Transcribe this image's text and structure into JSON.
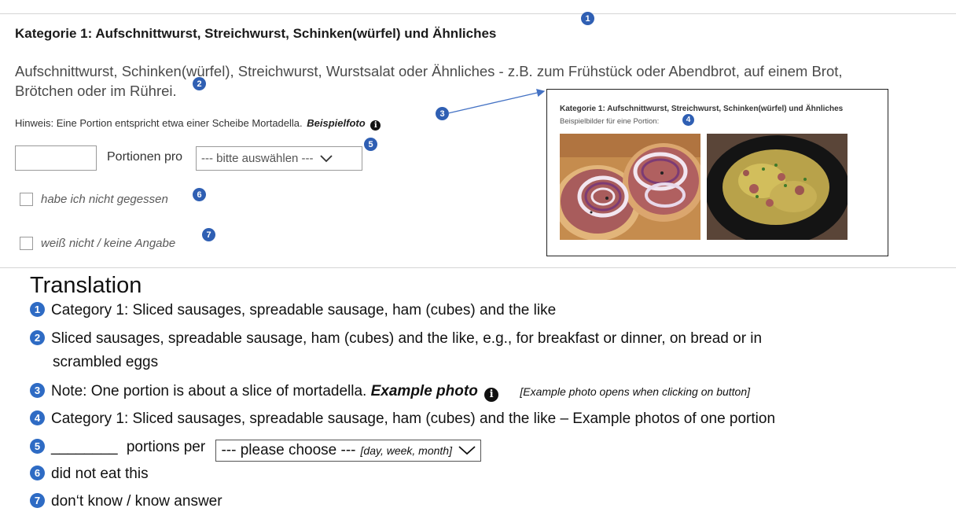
{
  "form": {
    "category_title": "Kategorie 1: Aufschnittwurst, Streichwurst, Schinken(würfel) und Ähnliches",
    "description_line1": "Aufschnittwurst, Schinken(würfel), Streichwurst, Wurstsalat oder Ähnliches - z.B. zum Frühstück oder Abendbrot, auf einem Brot,",
    "description_line2": "Brötchen oder im Rührei.",
    "hint_text": "Hinweis: Eine Portion entspricht etwa einer Scheibe Mortadella.",
    "example_photo_link": "Beispielfoto",
    "portions_label": "Portionen pro",
    "select_value": "--- bitte auswählen ---",
    "checkbox_not_eaten": "habe ich nicht gegessen",
    "checkbox_dont_know": "weiß nicht / keine Angabe"
  },
  "popup": {
    "title": "Kategorie 1: Aufschnittwurst, Streichwurst, Schinken(würfel) und Ähnliches",
    "subtitle": "Beispielbilder für eine Portion:"
  },
  "badges": [
    "1",
    "2",
    "3",
    "4",
    "5",
    "6",
    "7"
  ],
  "translation": {
    "heading": "Translation",
    "line1": "Category 1: Sliced sausages, spreadable sausage, ham (cubes) and the like",
    "line2a": "Sliced sausages, spreadable sausage, ham (cubes) and the like, e.g., for breakfast or dinner, on bread or in",
    "line2b": "scrambled eggs",
    "line3_text": "Note: One portion is about a slice of mortadella.",
    "line3_bold": "Example photo",
    "line3_note": "[Example photo opens when clicking on button]",
    "line4": "Category 1: Sliced sausages, spreadable sausage, ham (cubes) and the like – Example photos of one portion",
    "line5_blank": "________",
    "line5_text": "portions per",
    "line5_select": "--- please choose ---",
    "line5_options": "[day, week, month]",
    "line6": "did not eat this",
    "line7": "don‘t know / know answer"
  },
  "colors": {
    "badge": "#2f5fb3",
    "arrow": "#4472c4",
    "rule": "#d5d5d5"
  }
}
